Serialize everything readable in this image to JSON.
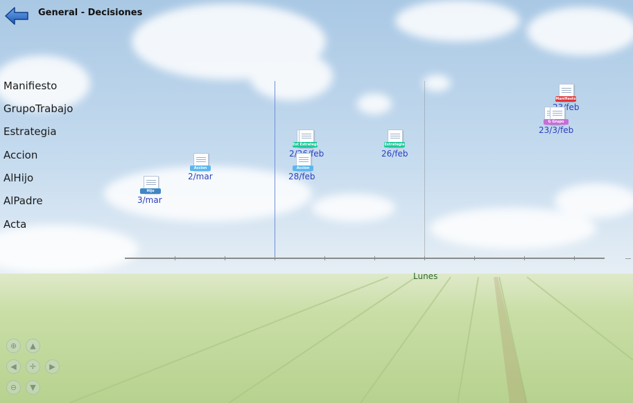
{
  "header": {
    "title": "General - Decisiones"
  },
  "rows": [
    "Manifiesto",
    "GrupoTrabajo",
    "Estrategia",
    "Accion",
    "AlHijo",
    "AlPadre",
    "Acta"
  ],
  "axis": {
    "label": "Lunes"
  },
  "items": [
    {
      "badge": "Hijo",
      "date": "3/mar",
      "color": "#3f86c7"
    },
    {
      "badge": "Accion",
      "date": "2/mar",
      "color": "#5cb6ee"
    },
    {
      "badge": "Est Estrategia",
      "date": "2/26/feb",
      "color": "#1fc99b"
    },
    {
      "badge": "Accion",
      "date": "28/feb",
      "color": "#5cb6ee"
    },
    {
      "badge": "Estrategia",
      "date": "26/feb",
      "color": "#1fc99b"
    },
    {
      "badge": "Manifiesto",
      "date": "23/feb",
      "color": "#e0353a"
    },
    {
      "badge": "G  Grupo",
      "date": "23/3/feb",
      "color": "#c86dd7"
    }
  ],
  "nav": {
    "zoom_in": "⊕",
    "up": "▲",
    "left": "◀",
    "center": "✛",
    "right": "▶",
    "zoom_out": "⊖",
    "down": "▼",
    "zoom_in_icon": "zoom-in-icon",
    "pan_icon": "arrow-icon"
  },
  "colors": {
    "accent_line": "#6f8fd6",
    "axis_label": "#2d6b2d",
    "date_text": "#2a3fbf"
  }
}
